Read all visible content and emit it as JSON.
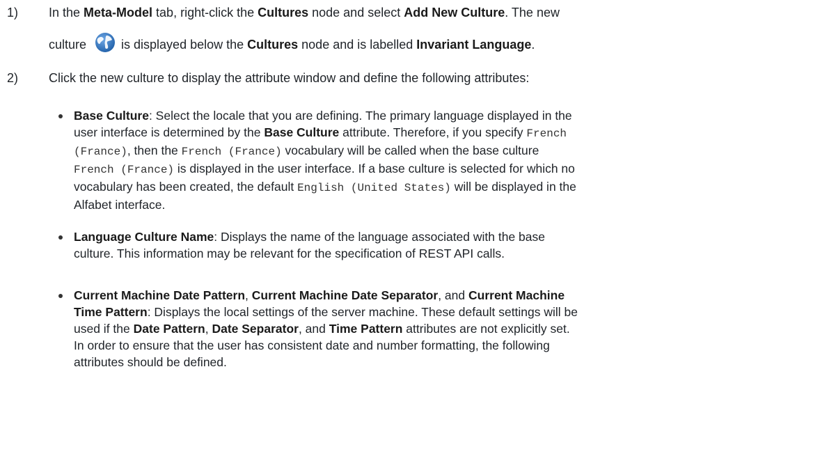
{
  "step1": {
    "number": "1)",
    "line1": {
      "t1": "In the ",
      "b1": "Meta-Model",
      "t2": " tab, right-click the ",
      "b2": "Cultures",
      "t3": " node and select ",
      "b3": "Add New Culture",
      "t4": ". The new"
    },
    "line2": {
      "t1": "culture",
      "t2": "is displayed below the ",
      "b1": "Cultures",
      "t3": " node and is labelled ",
      "b2": "Invariant Language",
      "t4": "."
    },
    "icon": "globe-icon"
  },
  "step2": {
    "number": "2)",
    "text": "Click the new culture to display the attribute window and define the following attributes:"
  },
  "bullets": [
    {
      "lines": [
        {
          "b1": "Base Culture",
          "t1": ": Select the locale that you are defining. The primary language displayed in the"
        },
        {
          "t1": "user interface is determined by the ",
          "b1": "Base Culture",
          "t2": " attribute. Therefore, if you specify ",
          "c1": "French"
        },
        {
          "c1": "(France)",
          "t1": ", then the ",
          "c2": "French (France)",
          "t2": " vocabulary will be called when the base culture"
        },
        {
          "c1": "French (France)",
          "t1": " is displayed in the user interface. If a base culture is selected for which no"
        },
        {
          "t1": "vocabulary has been created, the default ",
          "c1": "English (United States)",
          "t2": " will be displayed in the"
        },
        {
          "t1": "Alfabet interface."
        }
      ]
    },
    {
      "lines": [
        {
          "b1": "Language Culture Name",
          "t1": ": Displays the name of the language associated with the base"
        },
        {
          "t1": "culture. This information may be relevant for the specification of REST API calls."
        }
      ]
    },
    {
      "lines": [
        {
          "b1": "Current Machine Date Pattern",
          "t1": ", ",
          "b2": "Current Machine Date Separator",
          "t2": ", and ",
          "b3": "Current Machine"
        },
        {
          "b1": "Time Pattern",
          "t1": ": Displays the local settings of the server machine. These default settings will be"
        },
        {
          "t1": "used if the ",
          "b1": "Date Pattern",
          "t2": ", ",
          "b2": "Date Separator",
          "t3": ", and ",
          "b3": "Time Pattern",
          "t4": " attributes are not explicitly set."
        },
        {
          "t1": "In order to ensure that the user has consistent date and number formatting, the following"
        },
        {
          "t1": "attributes should be defined."
        }
      ]
    }
  ],
  "colors": {
    "text": "#1f2328",
    "globe": "#2a6ebb"
  }
}
